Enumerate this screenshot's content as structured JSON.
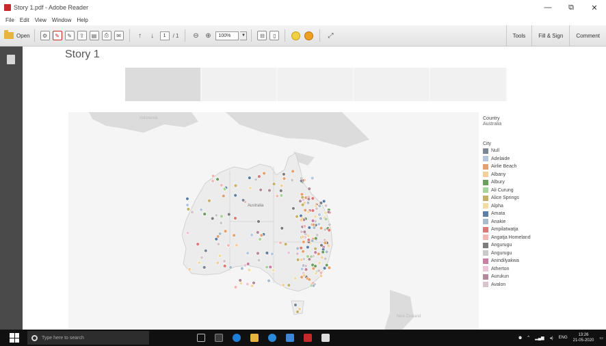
{
  "window": {
    "title": "Story 1.pdf - Adobe Reader",
    "controls": [
      "—",
      "⧉",
      "✕"
    ]
  },
  "menu": [
    "File",
    "Edit",
    "View",
    "Window",
    "Help"
  ],
  "toolbar": {
    "open_label": "Open",
    "page_current": "1",
    "page_total": "/ 1",
    "zoom_value": "100%",
    "right_links": [
      "Tools",
      "Fill & Sign",
      "Comment"
    ]
  },
  "document": {
    "story_title": "Story 1"
  },
  "map": {
    "labels": [
      "Indonesia",
      "New Zealand",
      "Australia"
    ]
  },
  "legend": {
    "country_label": "Country",
    "country_value": "Australia",
    "city_label": "City",
    "items": [
      {
        "label": "Null",
        "color": "#7b8794"
      },
      {
        "label": "Adelaide",
        "color": "#b5c7df"
      },
      {
        "label": "Airlie Beach",
        "color": "#e5a06b"
      },
      {
        "label": "Albany",
        "color": "#f2cf9d"
      },
      {
        "label": "Albury",
        "color": "#6c9e5e"
      },
      {
        "label": "Ali Curung",
        "color": "#a8d39d"
      },
      {
        "label": "Alice Springs",
        "color": "#c4b06b"
      },
      {
        "label": "Alpha",
        "color": "#f0dda6"
      },
      {
        "label": "Amata",
        "color": "#5d7fa6"
      },
      {
        "label": "Anakie",
        "color": "#a8bcc9"
      },
      {
        "label": "Ampilatwatja",
        "color": "#d97a77"
      },
      {
        "label": "Angatja Homeland",
        "color": "#f0b8b4"
      },
      {
        "label": "Angurugu",
        "color": "#7d7d7d"
      },
      {
        "label": "Angurugu",
        "color": "#c9c9c9"
      },
      {
        "label": "Anindilyakwa",
        "color": "#c77fa2"
      },
      {
        "label": "Atherton",
        "color": "#edc4d8"
      },
      {
        "label": "Aurukun",
        "color": "#b0899b"
      },
      {
        "label": "Avalon",
        "color": "#d9c3cc"
      }
    ]
  },
  "taskbar": {
    "search_placeholder": "Type here to search",
    "time": "13:26",
    "date": "21-05-2020",
    "tray_lang": "ENG"
  }
}
